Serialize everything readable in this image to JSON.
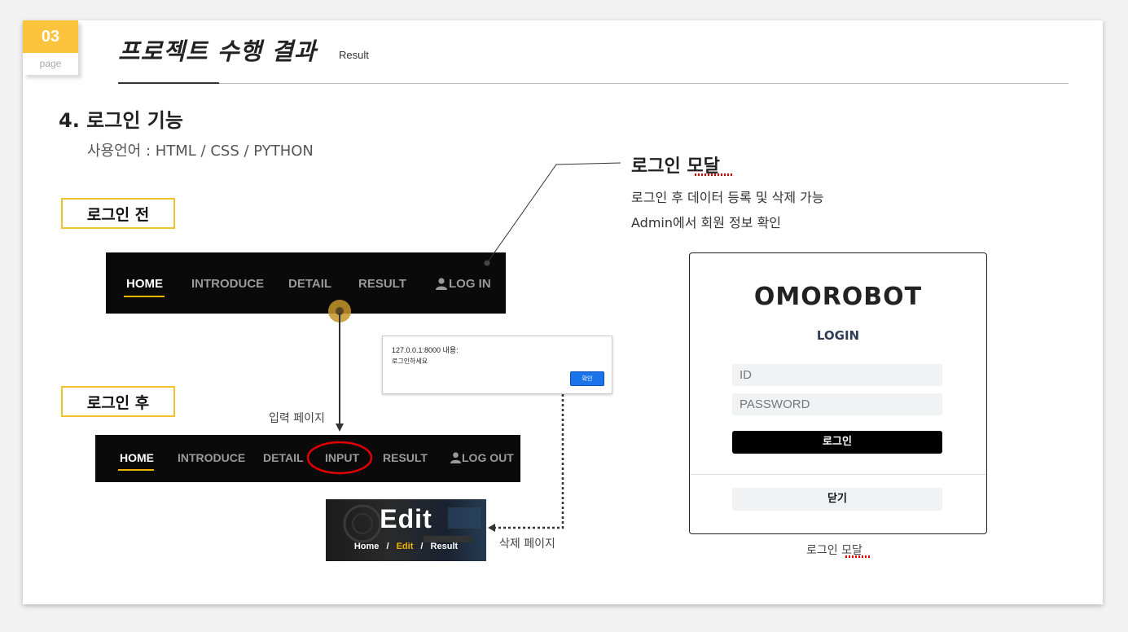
{
  "page": {
    "number": "03",
    "label": "page"
  },
  "header": {
    "title": "프로젝트 수행 결과",
    "subtitle": "Result"
  },
  "section": {
    "title": "4. 로그인 기능",
    "language": "사용언어 : HTML / CSS / PYTHON"
  },
  "before": {
    "tag": "로그인 전",
    "nav": {
      "home": "HOME",
      "introduce": "INTRODUCE",
      "detail": "DETAIL",
      "result": "RESULT",
      "login": "LOG IN"
    }
  },
  "after": {
    "tag": "로그인 후",
    "nav": {
      "home": "HOME",
      "introduce": "INTRODUCE",
      "detail": "DETAIL",
      "input": "INPUT",
      "result": "RESULT",
      "logout": "LOG OUT"
    }
  },
  "annotation": {
    "input_page": "입력 페이지",
    "delete_page": "삭제 페이지",
    "modal_title": "로그인 모달",
    "modal_desc1": "로그인 후 데이터 등록 및 삭제 가능",
    "modal_desc2": "Admin에서 회원 정보 확인",
    "modal_caption": "로그인 모달"
  },
  "alert": {
    "host": "127.0.0.1:8000 내용:",
    "message": "로그인하세요",
    "ok": "확인"
  },
  "edit_banner": {
    "title": "Edit",
    "crumb_home": "Home",
    "crumb_sep": "/",
    "crumb_current": "Edit",
    "crumb_result": "Result"
  },
  "login_modal": {
    "logo": "OMOROBOT",
    "heading": "LOGIN",
    "id_placeholder": "ID",
    "password_placeholder": "PASSWORD",
    "login_button": "로그인",
    "close_button": "닫기"
  },
  "colors": {
    "accent": "#fcc33c",
    "nav_bg": "#0a0a0a",
    "underline": "#f0b400",
    "highlight_circle": "#e00000"
  }
}
